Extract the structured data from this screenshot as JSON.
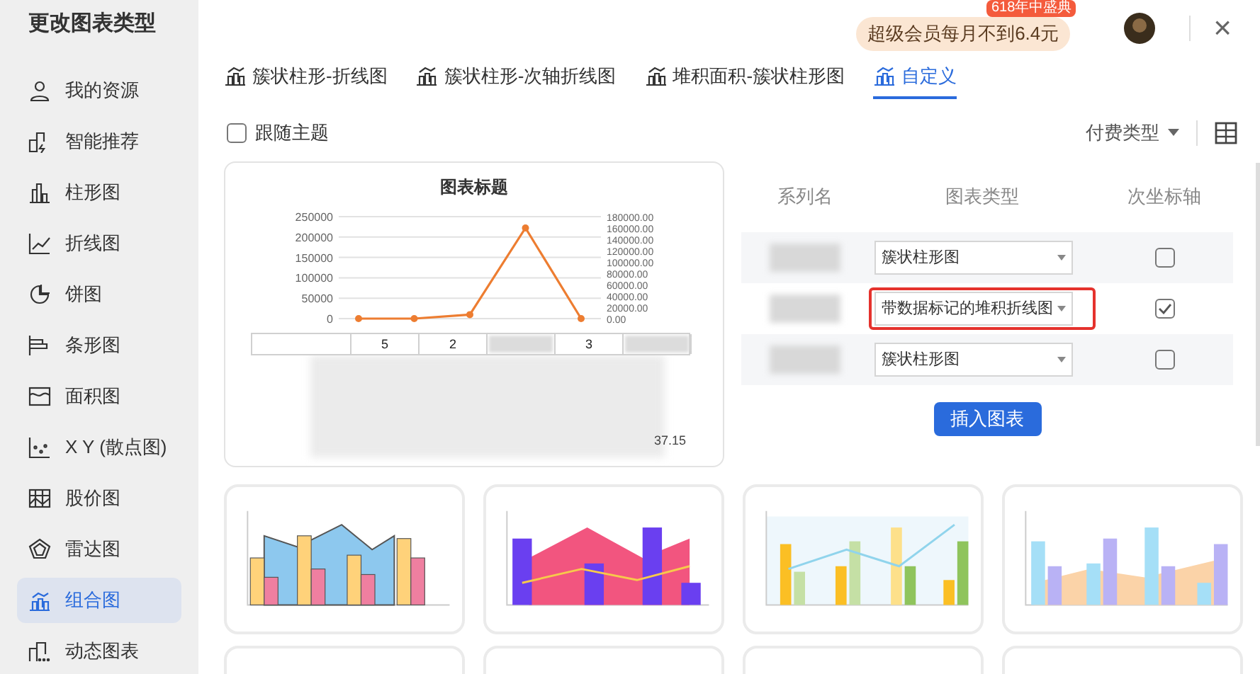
{
  "window": {
    "title": "更改图表类型",
    "promo": {
      "text": "超级会员每月不到6.4元",
      "badge": "618年中盛典"
    },
    "close": "×"
  },
  "sidebar": {
    "items": [
      {
        "label": "我的资源",
        "selected": false
      },
      {
        "label": "智能推荐",
        "selected": false
      },
      {
        "label": "柱形图",
        "selected": false
      },
      {
        "label": "折线图",
        "selected": false
      },
      {
        "label": "饼图",
        "selected": false
      },
      {
        "label": "条形图",
        "selected": false
      },
      {
        "label": "面积图",
        "selected": false
      },
      {
        "label": "X Y (散点图)",
        "selected": false
      },
      {
        "label": "股价图",
        "selected": false
      },
      {
        "label": "雷达图",
        "selected": false
      },
      {
        "label": "组合图",
        "selected": true
      },
      {
        "label": "动态图表",
        "selected": false
      }
    ]
  },
  "tabs": [
    {
      "label": "簇状柱形-折线图",
      "selected": false
    },
    {
      "label": "簇状柱形-次轴折线图",
      "selected": false
    },
    {
      "label": "堆积面积-簇状柱形图",
      "selected": false
    },
    {
      "label": "自定义",
      "selected": true
    }
  ],
  "follow_theme": {
    "label": "跟随主题",
    "checked": false
  },
  "filter": {
    "label": "付费类型"
  },
  "preview": {
    "chart_data": {
      "type": "line",
      "title": "图表标题",
      "series": [
        {
          "color": "#ed7d31",
          "marker": true,
          "values": [
            0,
            0,
            7000,
            160000,
            0
          ]
        }
      ],
      "ylim": [
        0,
        180000
      ],
      "yticks": [
        {
          "value": 0,
          "label": "0.00"
        },
        {
          "value": 20000,
          "label": "20000.00"
        },
        {
          "value": 40000,
          "label": "40000.00"
        },
        {
          "value": 60000,
          "label": "60000.00"
        },
        {
          "value": 80000,
          "label": "80000.00"
        },
        {
          "value": 100000,
          "label": "100000.00"
        },
        {
          "value": 120000,
          "label": "120000.00"
        },
        {
          "value": 140000,
          "label": "140000.00"
        },
        {
          "value": 160000,
          "label": "160000.00"
        },
        {
          "value": 180000,
          "label": "180000.00"
        }
      ]
    },
    "left_ticks": [
      "250000",
      "200000",
      "150000",
      "100000",
      "50000",
      "0"
    ],
    "table_header": [
      {
        "text": "5",
        "blurred": false
      },
      {
        "text": "2",
        "blurred": false
      },
      {
        "blurred": true
      },
      {
        "text": "3",
        "blurred": false
      },
      {
        "blurred": true
      }
    ],
    "table_last": "37.15"
  },
  "series_table": {
    "columns": [
      "系列名",
      "图表类型",
      "次坐标轴"
    ],
    "rows": [
      {
        "chart_type": "簇状柱形图",
        "secondary_axis": false,
        "highlighted": false
      },
      {
        "chart_type": "带数据标记的堆积折线图",
        "secondary_axis": true,
        "highlighted": true
      },
      {
        "chart_type": "簇状柱形图",
        "secondary_axis": false,
        "highlighted": false
      }
    ]
  },
  "insert_button": "插入图表",
  "thumbnails": [
    {
      "kind": "area-column"
    },
    {
      "kind": "gradient"
    },
    {
      "kind": "line-column"
    },
    {
      "kind": "pattern"
    },
    {
      "kind": "partial"
    },
    {
      "kind": "partial"
    },
    {
      "kind": "partial"
    },
    {
      "kind": "partial"
    }
  ]
}
